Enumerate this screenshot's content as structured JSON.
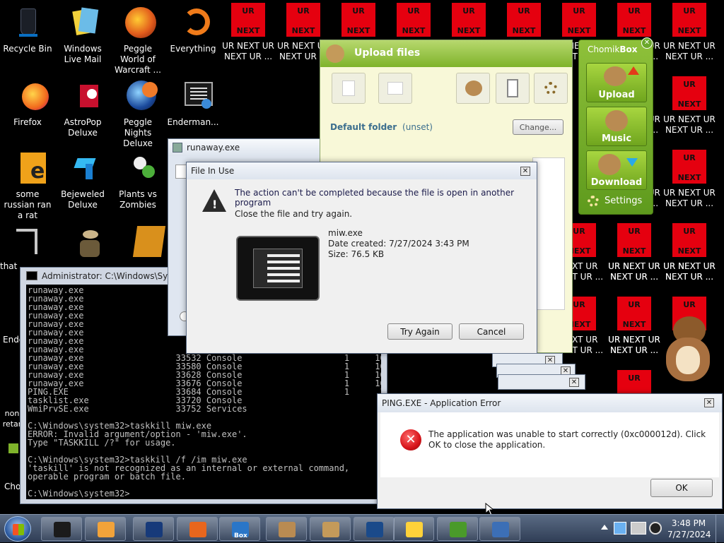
{
  "desktop_icons": [
    {
      "label": "Recycle Bin",
      "icon": "recycle-bin-icon"
    },
    {
      "label": "Windows Live Mail",
      "icon": "mail-icon"
    },
    {
      "label": "Peggle World of Warcraft ...",
      "icon": "peggle-icon"
    },
    {
      "label": "Everything",
      "icon": "everything-icon"
    },
    {
      "label": "Firefox",
      "icon": "firefox-icon"
    },
    {
      "label": "AstroPop Deluxe",
      "icon": "astropop-icon"
    },
    {
      "label": "Peggle Nights Deluxe",
      "icon": "peggle-nights-icon"
    },
    {
      "label": "Enderman...",
      "icon": "enderman-icon"
    },
    {
      "label": "some russian ran a rat",
      "icon": "russian-icon"
    },
    {
      "label": "Bejeweled Deluxe",
      "icon": "bejeweled-icon"
    },
    {
      "label": "Plants vs Zombies",
      "icon": "plants-icon"
    },
    {
      "label": "that",
      "icon": "shortcut-icon"
    },
    {
      "label": "Ende",
      "icon": "shortcut-icon"
    },
    {
      "label": "non retar",
      "icon": "shortcut-icon"
    },
    {
      "label": "Cho",
      "icon": "shortcut-icon"
    }
  ],
  "ur_box": {
    "top": "UR",
    "bottom": "NEXT"
  },
  "ur_caption": "UR NEXT UR NEXT UR ...",
  "ur_caption_short": "NEXT UR NEXT UR ...",
  "ur_caption_partial": "NEXT UR NEXT UR ...",
  "ur_caption_cut": "XT UR ...",
  "ur_caption_ne": "NE",
  "ur_caption_ur": "UR",
  "upload": {
    "title": "Upload files",
    "default_folder_label": "Default folder",
    "default_folder_value": "(unset)",
    "change_button": "Change..."
  },
  "chomik": {
    "brand_a": "Chomik",
    "brand_b": "Box",
    "upload": "Upload",
    "music": "Music",
    "download": "Download",
    "settings": "Settings"
  },
  "runaway": {
    "title": "runaway.exe"
  },
  "file_in_use": {
    "title": "File In Use",
    "message": "The action can't be completed because the file is open in another program",
    "sub": "Close the file and try again.",
    "file_name": "miw.exe",
    "date_created": "Date created: 7/27/2024 3:43 PM",
    "size": "Size: 76.5 KB",
    "try_again": "Try Again",
    "cancel": "Cancel"
  },
  "console": {
    "title": "Administrator: C:\\Windows\\System",
    "text": "runaway.exe\nrunaway.exe\nrunaway.exe\nrunaway.exe\nrunaway.exe\nrunaway.exe\nrunaway.exe\nrunaway.exe\nrunaway.exe                  33532 Console                    1     10,480 K\nrunaway.exe                  33580 Console                    1     10,460 K\nrunaway.exe                  33628 Console                    1     10,480 K\nrunaway.exe                  33676 Console                    1     10,456 K\nPING.EXE                     33684 Console                    1      3,844 K\ntasklist.exe                 33720 Console\nWmiPrvSE.exe                 33752 Services\n\nC:\\Windows\\system32>taskkill miw.exe\nERROR: Invalid argument/option - 'miw.exe'.\nType \"TASKKILL /?\" for usage.\n\nC:\\Windows\\system32>taskkill /f /im miw.exe\n'taskill' is not recognized as an internal or external command,\noperable program or batch file.\n\nC:\\Windows\\system32>"
  },
  "ping_error": {
    "title": "PING.EXE - Application Error",
    "message": "The application was unable to start correctly (0xc000012d). Click OK to close the application.",
    "ok": "OK"
  },
  "stacked_dialog_label": "XXX",
  "taskbar": {
    "time": "3:48 PM",
    "date": "7/27/2024",
    "items": [
      "media-player-icon",
      "ie-icon",
      "firefox-icon",
      "phone-icon",
      "chomikbox-icon",
      "chomik-upload-icon",
      "console-icon",
      "warning-icon",
      "error-icon",
      "warning-icon",
      "window-icon"
    ],
    "chomikbox_badge": "Box"
  },
  "colors": {
    "ur_red": "#e5000f",
    "chomik_green": "#7fb32b",
    "error_red": "#d7141a"
  }
}
